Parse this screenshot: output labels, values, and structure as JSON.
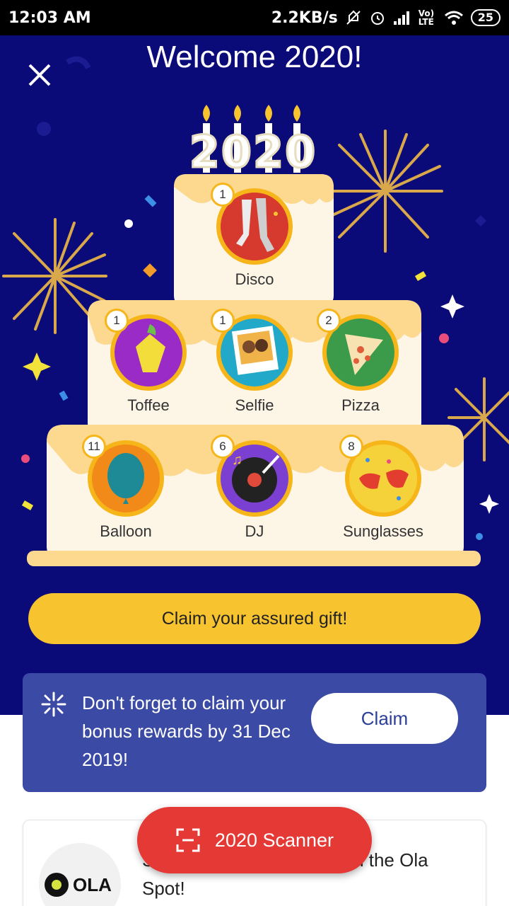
{
  "status_bar": {
    "time": "12:03 AM",
    "net_speed": "2.2KB/s",
    "network": "Vo) LTE",
    "battery": "25",
    "icons": [
      "mute-icon",
      "alarm-icon",
      "signal-icon",
      "wifi-icon",
      "battery-icon"
    ]
  },
  "header": {
    "title": "Welcome 2020!",
    "close_icon": "close-icon"
  },
  "cake": {
    "year": "2020",
    "badges": [
      {
        "label": "Disco",
        "count": "1"
      },
      {
        "label": "Toffee",
        "count": "1"
      },
      {
        "label": "Selfie",
        "count": "1"
      },
      {
        "label": "Pizza",
        "count": "2"
      },
      {
        "label": "Balloon",
        "count": "11"
      },
      {
        "label": "DJ",
        "count": "6"
      },
      {
        "label": "Sunglasses",
        "count": "8"
      }
    ]
  },
  "claim_gift": {
    "label": "Claim your assured gift!"
  },
  "bonus": {
    "icon": "sparkle-icon",
    "message": "Don't forget to claim your bonus rewards by 31 Dec 2019!",
    "button": "Claim"
  },
  "ola_card": {
    "logo_text": "OLA",
    "text": "S                                       n the Ola Spot!"
  },
  "scanner": {
    "label": "2020 Scanner",
    "icon": "scan-icon"
  },
  "colors": {
    "background": "#0a0a78",
    "gold": "#f7c430",
    "bonus_bg": "#3b4aa4",
    "scanner_red": "#e53935",
    "cake_cream": "#fdf5e6"
  }
}
